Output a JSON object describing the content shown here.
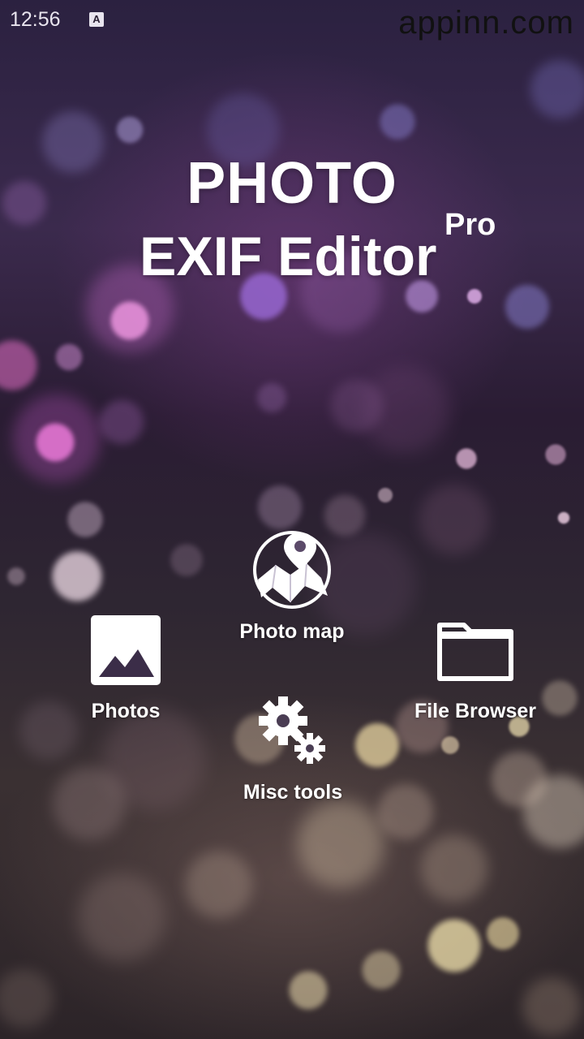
{
  "status_bar": {
    "time": "12:56",
    "notification_icon": "a-letter-icon",
    "watermark": "appinn.com"
  },
  "title": {
    "line1": "PHOTO",
    "line2": "EXIF Editor",
    "badge": "Pro"
  },
  "menu": {
    "photo_map": {
      "label": "Photo map",
      "icon": "map-pin-icon"
    },
    "photos": {
      "label": "Photos",
      "icon": "image-icon"
    },
    "file_browser": {
      "label": "File Browser",
      "icon": "folder-icon"
    },
    "misc_tools": {
      "label": "Misc tools",
      "icon": "gears-icon"
    }
  },
  "colors": {
    "text": "#ffffff",
    "background_top": "#2b2140",
    "background_bottom": "#2c2428",
    "bokeh_pink": "#e873d6",
    "bokeh_gold": "#f3e6b0"
  }
}
